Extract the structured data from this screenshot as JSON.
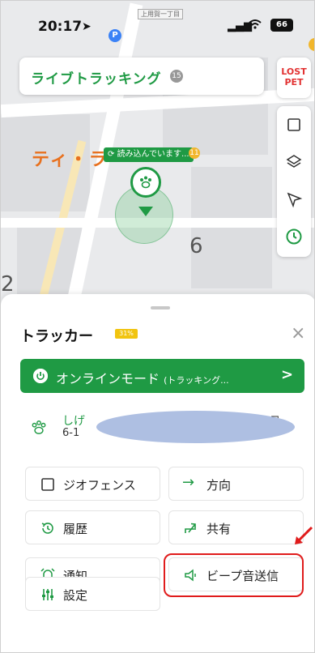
{
  "status_bar": {
    "time": "20:17",
    "location_icon": "location-arrow-icon",
    "p_badge": "P",
    "street_tag": "上用賀一丁目",
    "battery": "66"
  },
  "header": {
    "title": "ライブトラッキング",
    "badge": "15"
  },
  "lost_pet": {
    "label_line1": "LOST",
    "label_line2": "PET"
  },
  "map": {
    "orange_label": "ティ・ラ",
    "loading_text": "読み込んでいます...",
    "alert_badge": "11",
    "number_6": "6",
    "number_2": "2"
  },
  "sheet": {
    "title": "トラッカー",
    "battery_text": "31%",
    "close": "×",
    "online_mode": "オンラインモード",
    "online_mode_sub": "(トラッキング...",
    "online_chevron": ">",
    "address_name": "しげ",
    "address_sub": "6-1",
    "address_tail": "丁目",
    "buttons": {
      "geofence": "ジオフェンス",
      "direction": "方向",
      "history": "履歴",
      "share": "共有",
      "notify": "通知",
      "beep": "ビープ音送信",
      "settings": "設定"
    }
  },
  "colors": {
    "brand_green": "#1f9a44",
    "alert_red": "#e01b1b",
    "redact_blue": "#aebfe2",
    "accent_yellow": "#f1b62c"
  }
}
